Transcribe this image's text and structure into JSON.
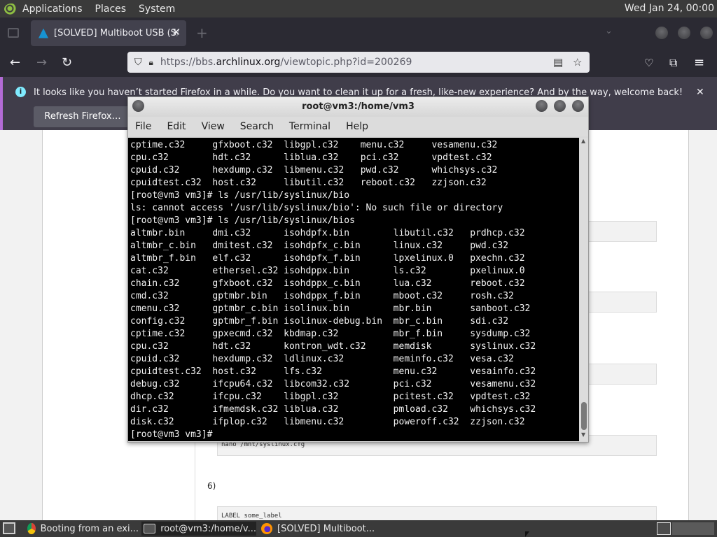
{
  "top_panel": {
    "menus": [
      "Applications",
      "Places",
      "System"
    ],
    "clock": "Wed Jan 24, 00:00"
  },
  "browser": {
    "tab_title": "[SOLVED] Multiboot USB (S",
    "tab_title_fade": "/",
    "url_prefix": "https://bbs.",
    "url_domain": "archlinux.org",
    "url_path": "/viewtopic.php?id=200269"
  },
  "notification": {
    "message": "It looks like you haven’t started Firefox in a while. Do you want to clean it up for a fresh, like-new experience? And by the way, welcome back!",
    "button": "Refresh Firefox…"
  },
  "page": {
    "code_line": "nano /mnt/syslinux.cfg",
    "step_label": "6)",
    "label_line": "LABEL some_label"
  },
  "terminal": {
    "title": "root@vm3:/home/vm3",
    "menu": [
      "File",
      "Edit",
      "View",
      "Search",
      "Terminal",
      "Help"
    ],
    "lines": [
      "cptime.c32     gfxboot.c32  libgpl.c32    menu.c32     vesamenu.c32",
      "cpu.c32        hdt.c32      liblua.c32    pci.c32      vpdtest.c32",
      "cpuid.c32      hexdump.c32  libmenu.c32   pwd.c32      whichsys.c32",
      "cpuidtest.c32  host.c32     libutil.c32   reboot.c32   zzjson.c32",
      "[root@vm3 vm3]# ls /usr/lib/syslinux/bio",
      "ls: cannot access '/usr/lib/syslinux/bio': No such file or directory",
      "[root@vm3 vm3]# ls /usr/lib/syslinux/bios",
      "altmbr.bin     dmi.c32      isohdpfx.bin        libutil.c32   prdhcp.c32",
      "altmbr_c.bin   dmitest.c32  isohdpfx_c.bin      linux.c32     pwd.c32",
      "altmbr_f.bin   elf.c32      isohdpfx_f.bin      lpxelinux.0   pxechn.c32",
      "cat.c32        ethersel.c32 isohdppx.bin        ls.c32        pxelinux.0",
      "chain.c32      gfxboot.c32  isohdppx_c.bin      lua.c32       reboot.c32",
      "cmd.c32        gptmbr.bin   isohdppx_f.bin      mboot.c32     rosh.c32",
      "cmenu.c32      gptmbr_c.bin isolinux.bin        mbr.bin       sanboot.c32",
      "config.c32     gptmbr_f.bin isolinux-debug.bin  mbr_c.bin     sdi.c32",
      "cptime.c32     gpxecmd.c32  kbdmap.c32          mbr_f.bin     sysdump.c32",
      "cpu.c32        hdt.c32      kontron_wdt.c32     memdisk       syslinux.c32",
      "cpuid.c32      hexdump.c32  ldlinux.c32         meminfo.c32   vesa.c32",
      "cpuidtest.c32  host.c32     lfs.c32             menu.c32      vesainfo.c32",
      "debug.c32      ifcpu64.c32  libcom32.c32        pci.c32       vesamenu.c32",
      "dhcp.c32       ifcpu.c32    libgpl.c32          pcitest.c32   vpdtest.c32",
      "dir.c32        ifmemdsk.c32 liblua.c32          pmload.c32    whichsys.c32",
      "disk.c32       ifplop.c32   libmenu.c32         poweroff.c32  zzjson.c32",
      "[root@vm3 vm3]# "
    ]
  },
  "taskbar": {
    "tasks": [
      "Booting from an exi...",
      "root@vm3:/home/v...",
      "[SOLVED] Multiboot..."
    ]
  }
}
